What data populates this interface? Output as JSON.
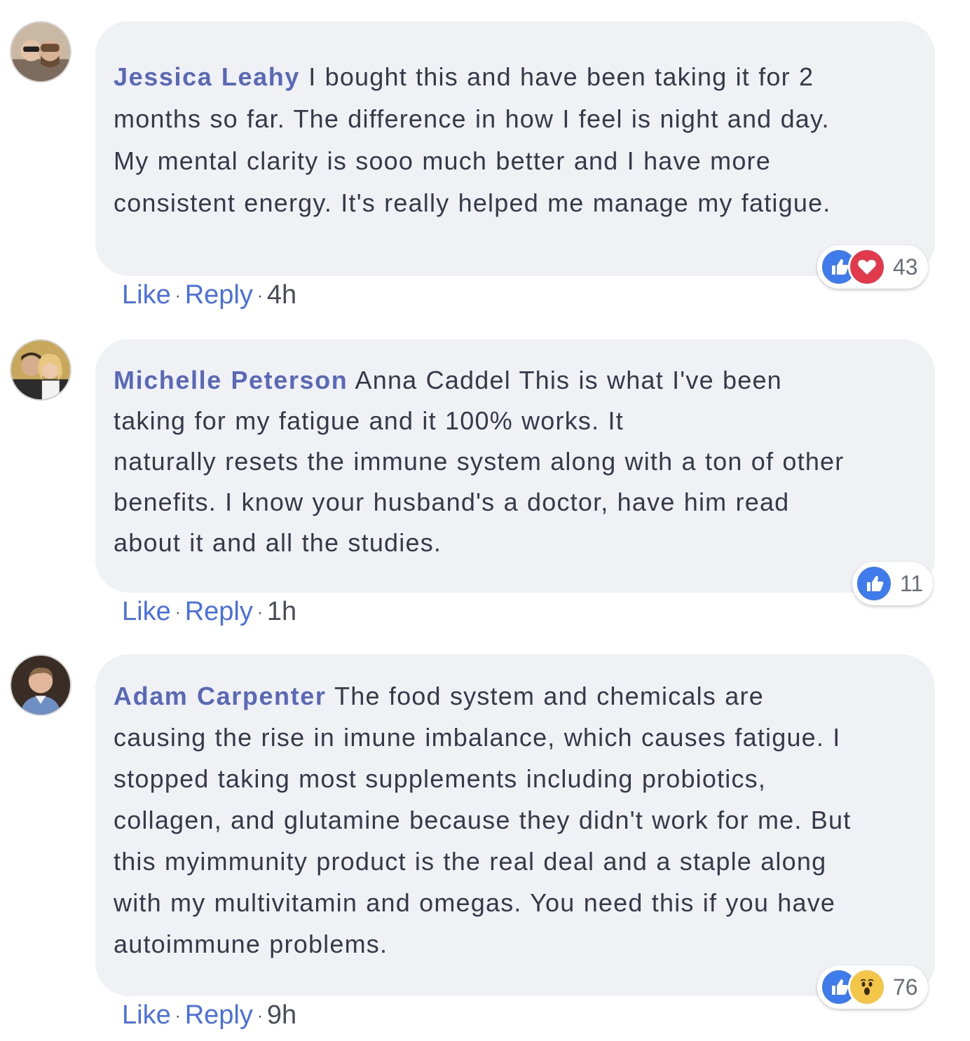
{
  "comments": [
    {
      "author": "Jessica Leahy",
      "text": "I bought this and have been taking it for 2",
      "lines": [
        "months so far. The difference in how I feel is night and day.",
        "My mental clarity is sooo much better and I have more",
        "consistent energy. It's really helped me manage my fatigue."
      ],
      "like_label": "Like",
      "reply_label": "Reply",
      "time": "4h",
      "reactions": [
        "like-icon",
        "love-icon"
      ],
      "reaction_count": "43"
    },
    {
      "author": "Michelle Peterson",
      "text": "Anna Caddel This is what I've been",
      "lines": [
        "taking for my fatigue and it 100% works. It",
        "naturally resets the immune system along with a ton of other",
        "benefits. I know your husband's a doctor, have him read",
        "about it and all the studies."
      ],
      "like_label": "Like",
      "reply_label": "Reply",
      "time": "1h",
      "reactions": [
        "like-icon"
      ],
      "reaction_count": "11"
    },
    {
      "author": "Adam Carpenter",
      "text": "The food system and chemicals are",
      "lines": [
        "causing the rise in imune imbalance, which causes fatigue. I",
        "stopped taking most supplements including probiotics,",
        "collagen, and glutamine because they didn't work for me. But",
        "this myimmunity product is the real deal and a staple along",
        "with my multivitamin and omegas. You need this if you have",
        "autoimmune problems."
      ],
      "like_label": "Like",
      "reply_label": "Reply",
      "time": "9h",
      "reactions": [
        "like-icon",
        "wow-icon"
      ],
      "reaction_count": "76"
    }
  ],
  "colors": {
    "bubble": "#f0f1f5",
    "author": "#5a68b8",
    "link": "#4a6fe0",
    "like": "#3f7bea",
    "love": "#e03a4c",
    "wow": "#f3c64a"
  }
}
